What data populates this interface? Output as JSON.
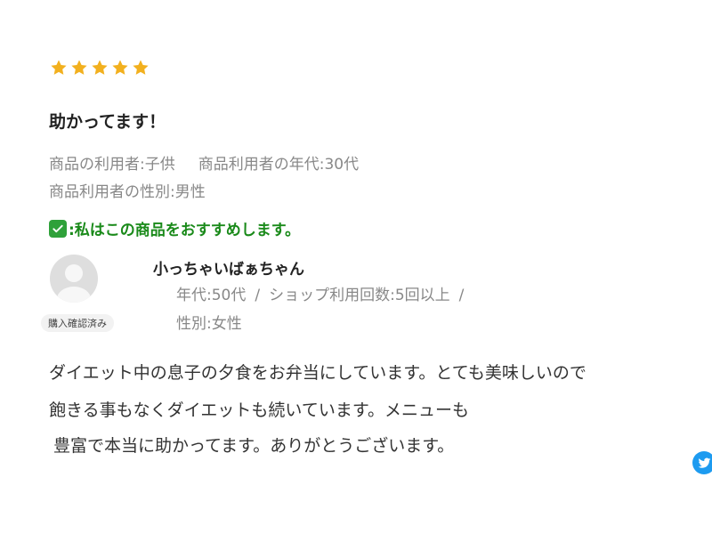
{
  "review": {
    "rating": 5,
    "max_rating": 5,
    "star_color": "#f2b01e",
    "title": "助かってます！",
    "meta": {
      "user": "商品の利用者:子供",
      "age": "商品利用者の年代:30代",
      "gender": "商品利用者の性別:男性"
    },
    "recommend": {
      "icon": "check-box-icon",
      "text": ":私はこの商品をおすすめします。",
      "color": "#1a8a1a"
    },
    "reviewer": {
      "avatar_icon": "default-user-avatar-icon",
      "badge": "購入確認済み",
      "name": "小っちゃいばぁちゃん",
      "age": "年代:50代",
      "shop_usage": "ショップ利用回数:5回以上",
      "separator": "/",
      "gender": "性別:女性"
    },
    "body": {
      "line1": "ダイエット中の息子の夕食をお弁当にしています。とても美味しいので",
      "line2": "飽きる事もなくダイエットも続いています。メニューも",
      "line3": "豊富で本当に助かってます。ありがとうございます。"
    }
  },
  "share": {
    "icon": "twitter-icon",
    "color": "#1d9bf0"
  }
}
